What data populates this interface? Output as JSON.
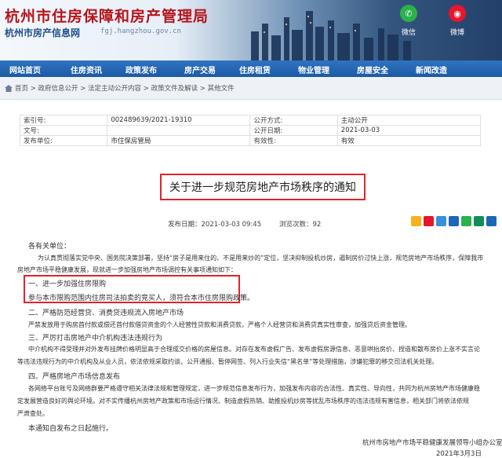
{
  "header": {
    "site_title": "杭州市住房保障和房产管理局",
    "site_subtitle": "杭州市房产信息网",
    "site_domain": "fgj.hangzhou.gov.cn",
    "social": [
      {
        "label": "微信",
        "icon": "wechat-icon",
        "color": "#2ab24b"
      },
      {
        "label": "微博",
        "icon": "weibo-icon",
        "color": "#e6162d"
      }
    ]
  },
  "nav": {
    "items": [
      {
        "label": "网站首页"
      },
      {
        "label": "住房资讯"
      },
      {
        "label": "政策发布"
      },
      {
        "label": "房产交易"
      },
      {
        "label": "住房租赁"
      },
      {
        "label": "物业管理"
      },
      {
        "label": "房屋安全"
      },
      {
        "label": "新闻改造"
      }
    ]
  },
  "breadcrumb": "首页 > 政府信息公开 > 法定主动公开内容 > 政策文件及解读 > 其他文件",
  "meta": {
    "rows": [
      {
        "k1": "索引号:",
        "v1": "002489639/2021-19310",
        "k2": "公开方式:",
        "v2": "主动公开"
      },
      {
        "k1": "文号:",
        "v1": "",
        "k2": "公开日期:",
        "v2": "2021-03-03"
      },
      {
        "k1": "发布单位:",
        "v1": "市住保房管局",
        "k2": "有效性:",
        "v2": "有效"
      }
    ]
  },
  "article": {
    "title": "关于进一步规范房地产市场秩序的通知",
    "publish_date": "发布日期：2021-03-03 09:45",
    "views": "浏览次数：92",
    "greeting": "各有关单位：",
    "intro_line1": "为认真贯彻落实党中央、国务院决策部署，坚持“房子是用来住的、不是用来炒的”定位，坚决抑制投机炒房，遏制房价过快上涨，规范房地产市场秩序，保障我市",
    "intro_line2": "房地产市场平稳健康发展，现就进一步加强房地产市场调控有关事项通知如下：",
    "s1_heading": "一、进一步加强住房限购",
    "s1_body": "参与本市限购范围内住房司法拍卖的竞买人，须符合本市住房限购政策。",
    "s2_heading": "二、严格防范经营贷、消费贷违规流入房地产市场",
    "s2_body": "严禁发放用于购房首付款或偿还首付款借贷资金的个人经营性贷款和消费贷款，严格个人经营贷和消费贷真实性审查，加强贷后资金管理。",
    "s3_heading": "三、严厉打击房地产中介机构违法违规行为",
    "s3_body1": "中介机构不得受理并对外发布挂牌价格明显高于合理成交价格的房屋信息。对存在发布虚假广告、发布虚假房源信息、恶意哄抬房价、捏造和散布房价上涨不实言论",
    "s3_body2": "等违法违规行为的中介机构及从业人员，依法依规采取约谈、公开通报、暂停网签、列入行业失信“黑名单”等处理措施，涉嫌犯罪的移交司法机关处理。",
    "s4_heading": "四、严格房地产市场信息发布",
    "s4_body1": "各网络平台账号及网络群要严格遵守相关法律法规和管理规定，进一步规范信息发布行为，加强发布内容的合法性、真实性、导向性，共同为杭州房地产市场健康稳",
    "s4_body2": "定发展营造良好的舆论环境。对不实传播杭州房地产政策和市场运行情况、制造虚假热销、助推投机炒房等扰乱市场秩序的违法违规有害信息，相关部门将依法依规",
    "s4_body3": "严肃查处。",
    "closing": "本通知自发布之日起施行。",
    "footer_org": "杭州市房地产市场平稳健康发展领导小组办公室",
    "footer_date": "2021年3月3日"
  },
  "share": {
    "icons": [
      {
        "name": "qzone-share-icon",
        "color": "#f7b21a"
      },
      {
        "name": "weibo-share-icon",
        "color": "#e6162d"
      },
      {
        "name": "tencent-weibo-share-icon",
        "color": "#3a8fd9"
      },
      {
        "name": "renren-share-icon",
        "color": "#1d66b8"
      },
      {
        "name": "wechat-share-icon",
        "color": "#2ab24b"
      },
      {
        "name": "douban-share-icon",
        "color": "#0f8e5b"
      },
      {
        "name": "more-share-icon",
        "color": "#1f67b4"
      }
    ]
  },
  "colors": {
    "brand_red": "#b8141b",
    "nav_blue": "#1c5aa3",
    "highlight_red": "#e1232b"
  }
}
